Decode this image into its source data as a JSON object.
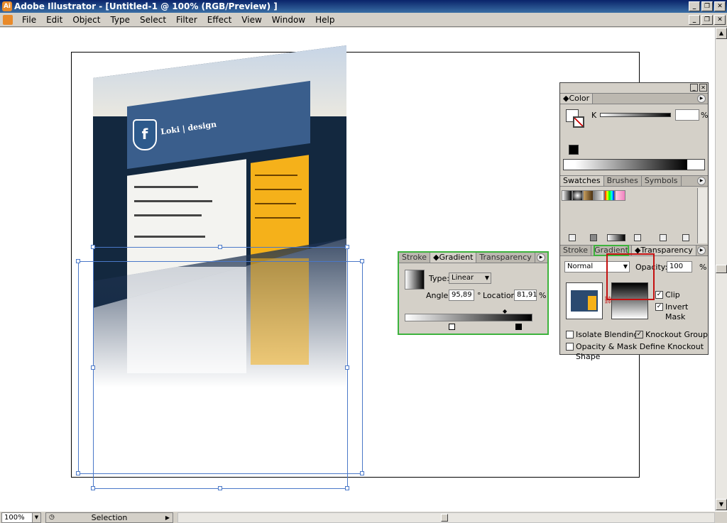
{
  "window": {
    "title": "Adobe Illustrator - [Untitled-1 @ 100% (RGB/Preview) ]"
  },
  "menu": [
    "File",
    "Edit",
    "Object",
    "Type",
    "Select",
    "Filter",
    "Effect",
    "View",
    "Window",
    "Help"
  ],
  "artwork": {
    "logo_text": "Loki | design"
  },
  "gradient_panel": {
    "tabs": [
      "Stroke",
      "Gradient",
      "Transparency"
    ],
    "active_tab": "Gradient",
    "type_label": "Type:",
    "type_value": "Linear",
    "angle_label": "Angle:",
    "angle_value": "95,89",
    "angle_unit": "°",
    "location_label": "Location:",
    "location_value": "81,91",
    "location_unit": "%"
  },
  "color_panel": {
    "tab": "Color",
    "k_label": "K",
    "k_unit": "%"
  },
  "swatch_panel": {
    "tabs": [
      "Swatches",
      "Brushes",
      "Symbols"
    ],
    "active_tab": "Swatches"
  },
  "transparency_panel": {
    "tabs": [
      "Stroke",
      "Gradient",
      "Transparency"
    ],
    "active_tab": "Transparency",
    "blend_mode": "Normal",
    "opacity_label": "Opacity:",
    "opacity_value": "100",
    "opacity_unit": "%",
    "clip_label": "Clip",
    "invert_mask_label": "Invert Mask",
    "isolate_blending_label": "Isolate Blending",
    "knockout_group_label": "Knockout Group",
    "opacity_mask_label": "Opacity & Mask Define Knockout Shape"
  },
  "status": {
    "zoom": "100%",
    "mode": "Selection"
  },
  "colors": {
    "highlight_green": "#3db33d",
    "highlight_red": "#c41010",
    "selection_blue": "#4a78c8"
  }
}
